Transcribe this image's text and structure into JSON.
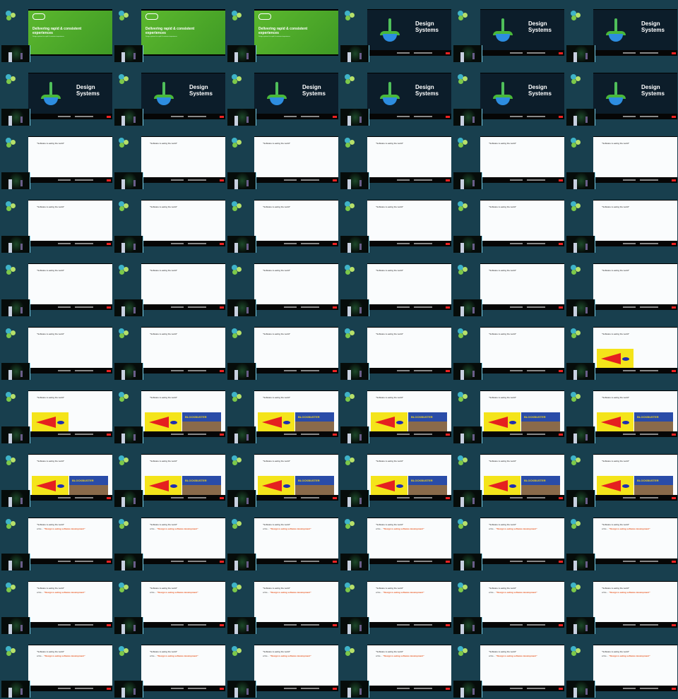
{
  "slides": {
    "green": {
      "title": "Delivering rapid & consistent experiences",
      "subtitle": "Design systems for rapid & consistent experiences"
    },
    "design": {
      "title": "Design Systems"
    },
    "software": {
      "quote": "\"Software is eating the world\""
    },
    "design_eating": {
      "prefix": "while...",
      "quote": "\"Design is eating software development\""
    },
    "blockbuster": {
      "sign": "BLOCKBUSTER"
    }
  },
  "colors": {
    "background": "#173e4d",
    "green_slide": "#4caa28",
    "dark_slide": "#0c1d2a",
    "accent_orange": "#e8531c"
  },
  "frames": [
    "green",
    "green",
    "green",
    "design",
    "design",
    "design",
    "design",
    "design",
    "design",
    "design",
    "design",
    "design",
    "software",
    "software",
    "software",
    "software",
    "software",
    "software",
    "software",
    "software",
    "software",
    "software",
    "software",
    "software",
    "software",
    "software",
    "software",
    "software",
    "software",
    "software",
    "software",
    "software",
    "software",
    "software",
    "software",
    "netflix",
    "netflix",
    "netflix_blockbuster",
    "netflix_blockbuster",
    "netflix_blockbuster",
    "netflix_blockbuster",
    "netflix_blockbuster",
    "netflix_blockbuster",
    "netflix_blockbuster",
    "netflix_blockbuster",
    "netflix_blockbuster",
    "netflix_blockbuster",
    "netflix_blockbuster",
    "design_eating",
    "design_eating",
    "design_eating",
    "design_eating",
    "design_eating",
    "design_eating",
    "design_eating",
    "design_eating",
    "design_eating",
    "design_eating",
    "design_eating",
    "design_eating",
    "design_eating",
    "design_eating",
    "design_eating",
    "design_eating",
    "design_eating",
    "design_eating"
  ]
}
